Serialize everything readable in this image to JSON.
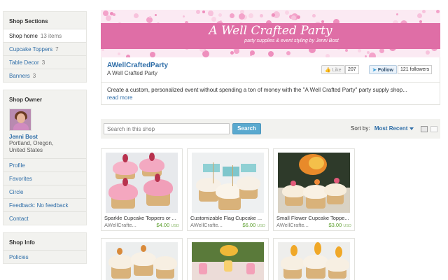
{
  "sidebar": {
    "sections_title": "Shop Sections",
    "sections": [
      {
        "label": "Shop home",
        "count": "13 items"
      },
      {
        "label": "Cupcake Toppers",
        "count": "7"
      },
      {
        "label": "Table Decor",
        "count": "3"
      },
      {
        "label": "Banners",
        "count": "3"
      }
    ],
    "owner_title": "Shop Owner",
    "owner_name": "Jenni Bost",
    "owner_location_1": "Portland, Oregon,",
    "owner_location_2": "United States",
    "owner_links": [
      "Profile",
      "Favorites",
      "Circle",
      "Feedback: No feedback",
      "Contact"
    ],
    "info_title": "Shop Info",
    "info_links": [
      "Policies"
    ]
  },
  "banner": {
    "title": "A Well Crafted Party",
    "subtitle": "party supplies & event styling by Jenni Bost",
    "colors": {
      "strip": "#df6ea6",
      "dots": "#f08cc0"
    }
  },
  "shop": {
    "name": "AWellCraftedParty",
    "tagline": "A Well Crafted Party",
    "like_label": "Like",
    "like_count": "207",
    "follow_label": "Follow",
    "followers": "121 followers",
    "description": "Create a custom, personalized event without spending a ton of money with the \"A Well Crafted Party\" party supply shop...",
    "read_more": "read more"
  },
  "search": {
    "placeholder": "Search in this shop",
    "button": "Search",
    "sort_label": "Sort by:",
    "sort_value": "Most Recent"
  },
  "items": [
    {
      "title": "Sparkle Cupcake Toppers or ...",
      "seller": "AWellCrafte...",
      "price": "$4.00",
      "currency": "USD"
    },
    {
      "title": "Customizable Flag Cupcake ...",
      "seller": "AWellCrafte...",
      "price": "$6.00",
      "currency": "USD"
    },
    {
      "title": "Small Flower Cupcake Toppe...",
      "seller": "AWellCrafte...",
      "price": "$3.00",
      "currency": "USD"
    }
  ]
}
